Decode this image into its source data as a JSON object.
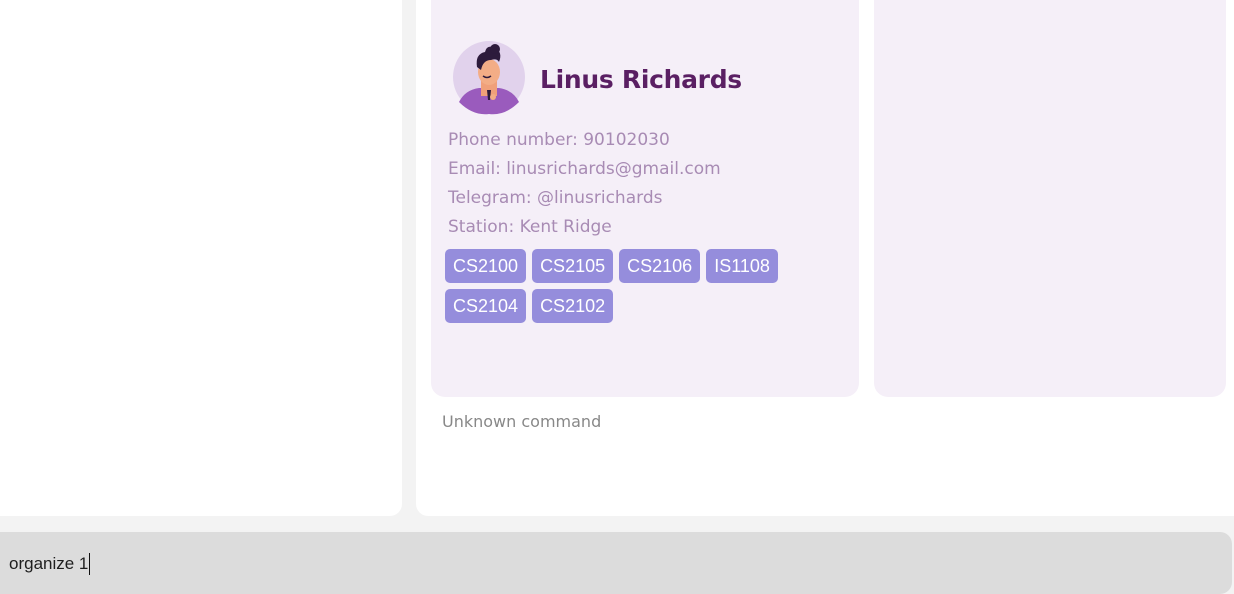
{
  "contact": {
    "name": "Linus Richards",
    "phone": "Phone number: 90102030",
    "email": "Email: linusrichards@gmail.com",
    "telegram": "Telegram: @linusrichards",
    "station": "Station: Kent Ridge",
    "tags": [
      "CS2100",
      "CS2105",
      "CS2106",
      "IS1108",
      "CS2104",
      "CS2102"
    ],
    "avatar_icon": "person-avatar-icon"
  },
  "result": {
    "message": "Unknown command"
  },
  "command": {
    "value": "organize 1"
  },
  "colors": {
    "name": "#5a1f63",
    "detail": "#a88bb4",
    "tag_bg": "#958ddc",
    "card_bg": "#f5eff8",
    "avatar_bg": "#e1d2ec"
  }
}
